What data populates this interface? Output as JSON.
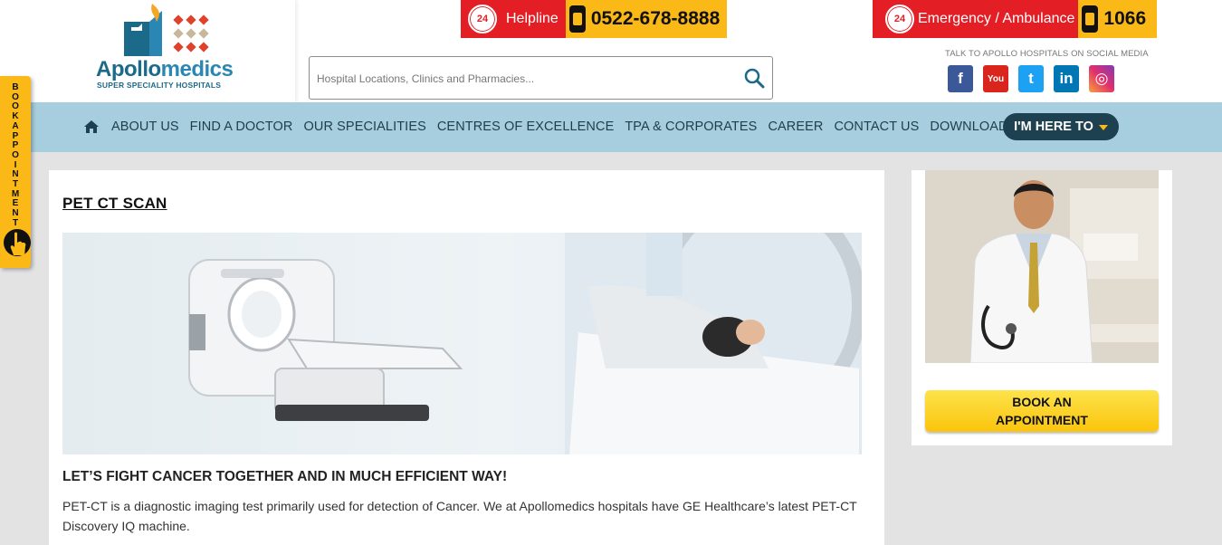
{
  "brand": {
    "logo_main": "Apollo",
    "logo_accent": "medics",
    "logo_sub": "SUPER SPECIALITY HOSPITALS"
  },
  "helpline": {
    "badge": "24",
    "label": "Helpline",
    "number": "0522-678-8888"
  },
  "emergency": {
    "badge": "24",
    "label": "Emergency / Ambulance",
    "number": "1066"
  },
  "search": {
    "placeholder": "Hospital Locations, Clinics and Pharmacies..."
  },
  "social": {
    "label": "TALK TO APOLLO HOSPITALS ON SOCIAL MEDIA",
    "icons": [
      "facebook-icon",
      "youtube-icon",
      "twitter-icon",
      "linkedin-icon",
      "instagram-icon"
    ],
    "fb": "f",
    "yt": "You",
    "tw": "t",
    "li": "in",
    "ig": "◎"
  },
  "nav": {
    "items": [
      {
        "label": "ABOUT US"
      },
      {
        "label": "FIND A DOCTOR"
      },
      {
        "label": "OUR SPECIALITIES"
      },
      {
        "label": "CENTRES OF EXCELLENCE"
      },
      {
        "label": "TPA & CORPORATES"
      },
      {
        "label": "CAREER"
      },
      {
        "label": "CONTACT US"
      },
      {
        "label": "DOWNLOAD REPORT"
      }
    ],
    "cta": "I'M HERE TO"
  },
  "side_tab": {
    "label": "BOOK APPOINTMENT"
  },
  "content": {
    "title": "PET CT SCAN",
    "subheading": "LET’S FIGHT CANCER TOGETHER AND IN MUCH EFFICIENT WAY!",
    "body": "PET-CT is a diagnostic imaging test primarily used for detection of Cancer. We at Apollomedics hospitals have GE Healthcare’s latest PET-CT Discovery IQ machine."
  },
  "sidebar": {
    "book_line1": "BOOK AN",
    "book_line2": "APPOINTMENT"
  },
  "colors": {
    "brand_blue": "#1c6a8a",
    "nav_bg": "#a7cede",
    "helpline_red": "#e31e24",
    "accent_yellow": "#fbb917",
    "cta_dark": "#1d4150"
  }
}
